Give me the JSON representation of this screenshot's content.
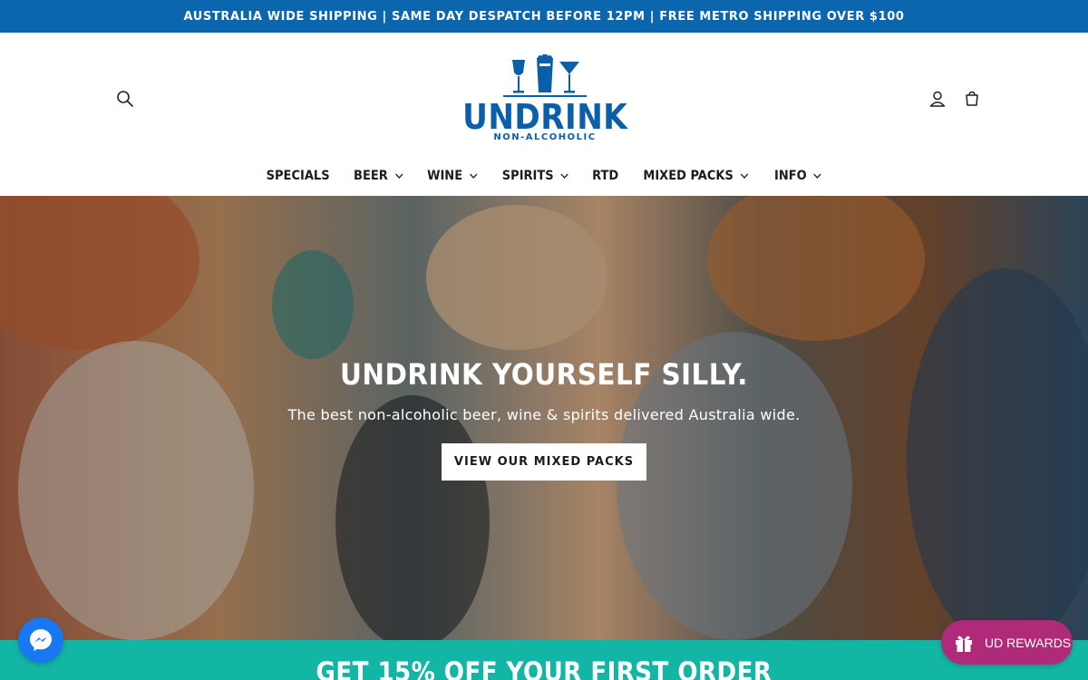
{
  "announcement": {
    "text": "AUSTRALIA WIDE SHIPPING | SAME DAY DESPATCH BEFORE 12PM | FREE METRO SHIPPING OVER $100"
  },
  "logo": {
    "word": "UNDRINK",
    "sub": "NON-ALCOHOLIC"
  },
  "header": {
    "icons": [
      "search-icon",
      "account-icon",
      "cart-icon"
    ]
  },
  "nav": {
    "items": [
      {
        "label": "SPECIALS",
        "dropdown": false
      },
      {
        "label": "BEER",
        "dropdown": true
      },
      {
        "label": "WINE",
        "dropdown": true
      },
      {
        "label": "SPIRITS",
        "dropdown": true
      },
      {
        "label": "RTD",
        "dropdown": false
      },
      {
        "label": "MIXED PACKS",
        "dropdown": true
      },
      {
        "label": "INFO",
        "dropdown": true
      }
    ]
  },
  "hero": {
    "title": "UNDRINK YOURSELF SILLY.",
    "subtitle": "The best non-alcoholic beer, wine & spirits delivered Australia wide.",
    "button_label": "VIEW OUR MIXED PACKS"
  },
  "promo": {
    "text": "GET 15% OFF YOUR FIRST ORDER"
  },
  "widgets": {
    "rewards_label": "UD REWARDS",
    "messenger_icon": "messenger-icon"
  },
  "colors": {
    "brand_blue": "#0b5ea8",
    "announcement_bg": "#0b66ad",
    "promo_teal": "#13b6a4",
    "rewards_magenta": "#b02a7a",
    "messenger_blue": "#1877f2"
  }
}
